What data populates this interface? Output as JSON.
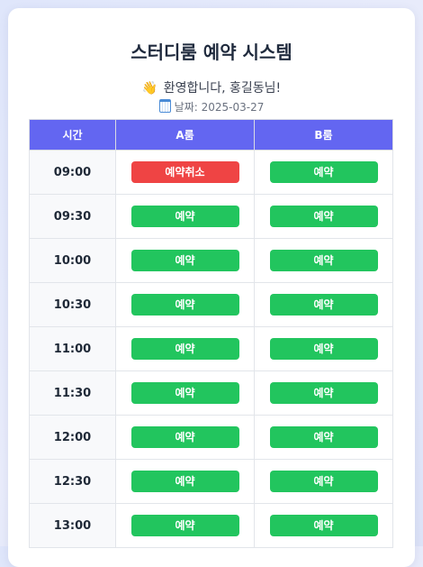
{
  "header": {
    "title": "스터디룸 예약 시스템",
    "welcome_icon": "waving-hand-icon",
    "welcome_emoji": "👋",
    "welcome_text": "환영합니다, 홍길동님!",
    "date_icon": "calendar-icon",
    "date_text": "날짜: 2025-03-27"
  },
  "table": {
    "columns": [
      "시간",
      "A룸",
      "B룸"
    ],
    "rows": [
      {
        "time": "09:00",
        "a": "예약취소",
        "b": "예약"
      },
      {
        "time": "09:30",
        "a": "예약",
        "b": "예약"
      },
      {
        "time": "10:00",
        "a": "예약",
        "b": "예약"
      },
      {
        "time": "10:30",
        "a": "예약",
        "b": "예약"
      },
      {
        "time": "11:00",
        "a": "예약",
        "b": "예약"
      },
      {
        "time": "11:30",
        "a": "예약",
        "b": "예약"
      },
      {
        "time": "12:00",
        "a": "예약",
        "b": "예약"
      },
      {
        "time": "12:30",
        "a": "예약",
        "b": "예약"
      },
      {
        "time": "13:00",
        "a": "예약",
        "b": "예약"
      }
    ]
  },
  "colors": {
    "header_bg": "#6366f1",
    "reserve": "#22c55e",
    "cancel": "#ef4444"
  }
}
